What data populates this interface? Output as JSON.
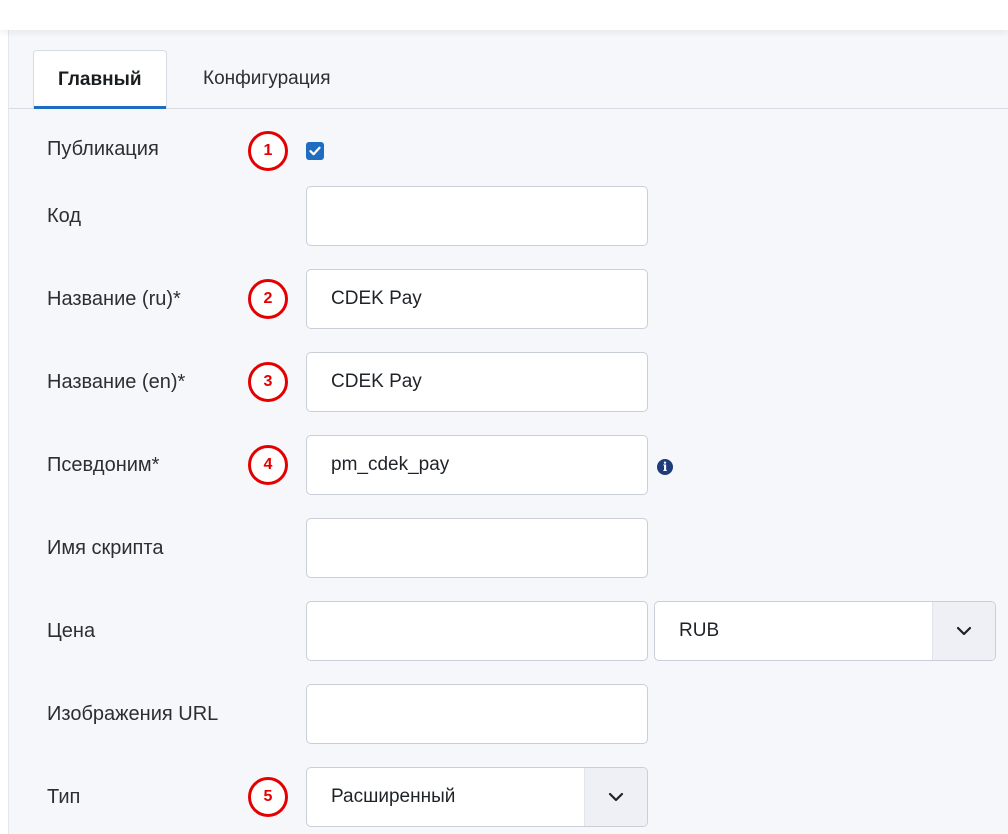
{
  "tabs": [
    {
      "label": "Главный",
      "active": true
    },
    {
      "label": "Конфигурация",
      "active": false
    }
  ],
  "form": {
    "publish": {
      "label": "Публикация",
      "checked": true,
      "marker": "1"
    },
    "code": {
      "label": "Код",
      "value": ""
    },
    "name_ru": {
      "label": "Название (ru)*",
      "value": "CDEK Pay",
      "marker": "2"
    },
    "name_en": {
      "label": "Название (en)*",
      "value": "CDEK Pay",
      "marker": "3"
    },
    "alias": {
      "label": "Псевдоним*",
      "value": "pm_cdek_pay",
      "marker": "4",
      "info_icon": "info-icon"
    },
    "script_name": {
      "label": "Имя скрипта",
      "value": ""
    },
    "price": {
      "label": "Цена",
      "value": "",
      "currency": "RUB"
    },
    "image_url": {
      "label": "Изображения URL",
      "value": ""
    },
    "type": {
      "label": "Тип",
      "value": "Расширенный",
      "marker": "5"
    }
  },
  "colors": {
    "accent": "#1f6dc1",
    "marker": "#e40000",
    "panel_bg": "#f6f7fa"
  }
}
